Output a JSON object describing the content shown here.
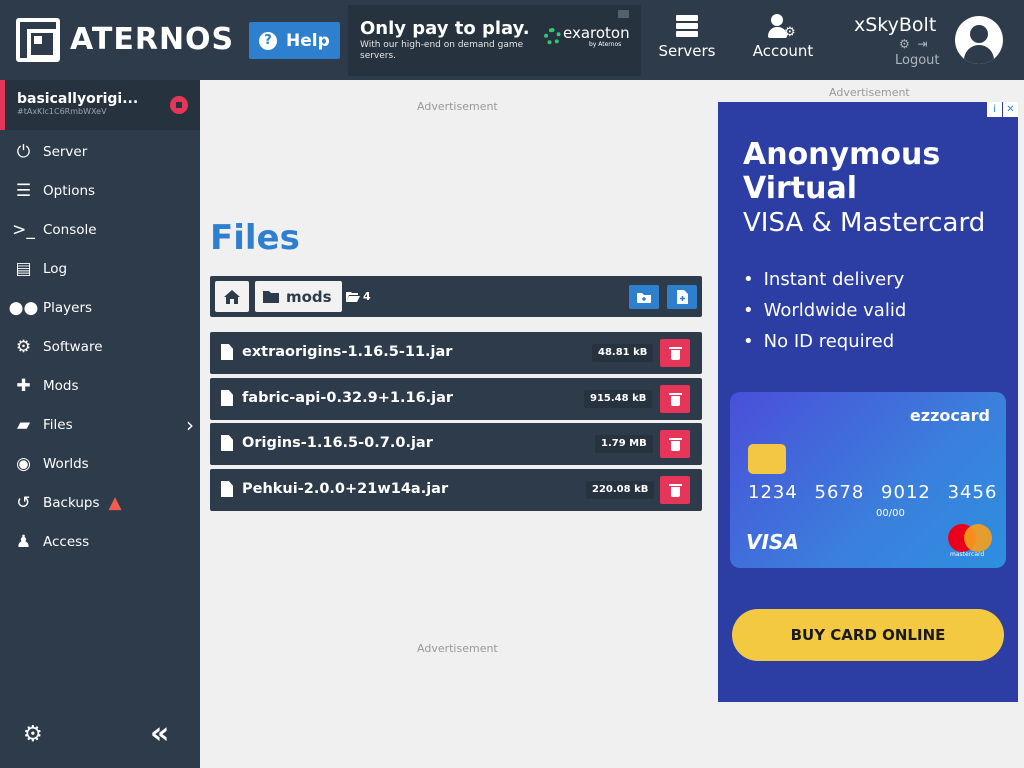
{
  "header": {
    "brand": "ATERNOS",
    "help_label": "Help",
    "promo": {
      "title": "Only pay to play.",
      "subtitle": "With our high-end on demand game servers.",
      "partner": "exaroton",
      "partner_by": "by Aternos"
    },
    "nav": {
      "servers_label": "Servers",
      "account_label": "Account"
    },
    "user": {
      "name": "xSkyBolt",
      "logout_label": "Logout"
    }
  },
  "sidebar": {
    "server": {
      "name": "basicallyorigi...",
      "id": "#tAxKlc1C6RmbWXeV"
    },
    "items": [
      {
        "label": "Server",
        "icon": "power-icon"
      },
      {
        "label": "Options",
        "icon": "sliders-icon"
      },
      {
        "label": "Console",
        "icon": "terminal-icon"
      },
      {
        "label": "Log",
        "icon": "document-icon"
      },
      {
        "label": "Players",
        "icon": "users-icon"
      },
      {
        "label": "Software",
        "icon": "gears-icon"
      },
      {
        "label": "Mods",
        "icon": "puzzle-icon"
      },
      {
        "label": "Files",
        "icon": "folder-open-icon"
      },
      {
        "label": "Worlds",
        "icon": "globe-icon"
      },
      {
        "label": "Backups",
        "icon": "history-icon"
      },
      {
        "label": "Access",
        "icon": "user-lock-icon"
      }
    ]
  },
  "main": {
    "ad_label": "Advertisement",
    "title": "Files",
    "breadcrumb": {
      "folder": "mods",
      "count": "4"
    },
    "files": [
      {
        "name": "extraorigins-1.16.5-11.jar",
        "size": "48.81 kB"
      },
      {
        "name": "fabric-api-0.32.9+1.16.jar",
        "size": "915.48 kB"
      },
      {
        "name": "Origins-1.16.5-0.7.0.jar",
        "size": "1.79 MB"
      },
      {
        "name": "Pehkui-2.0.0+21w14a.jar",
        "size": "220.08 kB"
      }
    ]
  },
  "ad": {
    "label": "Advertisement",
    "headline1": "Anonymous Virtual",
    "headline2": "VISA & Mastercard",
    "bullets": [
      "Instant delivery",
      "Worldwide valid",
      "No ID required"
    ],
    "card": {
      "brand": "ezzocard",
      "number": "1234 5678 9012 3456",
      "expiry": "00/00",
      "network": "VISA",
      "mc_label": "mastercard"
    },
    "cta": "BUY CARD ONLINE"
  },
  "colors": {
    "header_bg": "#2e3b4a",
    "accent_blue": "#2f7fcf",
    "danger_red": "#e53559",
    "ad_yellow": "#f2c940"
  }
}
